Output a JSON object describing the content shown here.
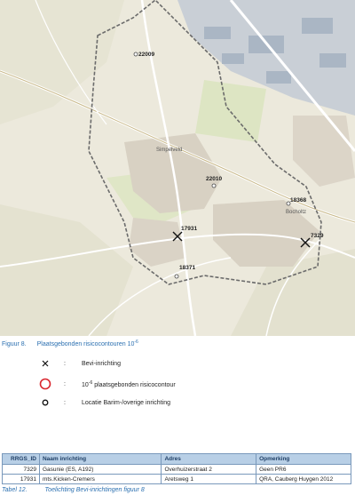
{
  "map": {
    "labels": [
      "22009",
      "22010",
      "18368",
      "17931",
      "7329",
      "18371"
    ],
    "place_names": [
      "Simpelveld",
      "Bocholtz"
    ],
    "colors": {
      "background": "#ece9dc",
      "urban": "#d7d1c4",
      "industrial": "#b9c3cf",
      "green": "#d9e3c0",
      "road": "#ffffff",
      "contour": "#6b6b6b",
      "label": "#222222"
    }
  },
  "figure_caption": {
    "number": "Figuur 8.",
    "text": "Plaatsgebonden risicocontouren 10",
    "exponent": "-6"
  },
  "legend": {
    "items": [
      {
        "symbol": "x",
        "colon": ":",
        "label": "Bevi-inrichting"
      },
      {
        "symbol": "red-circle",
        "colon": ":",
        "label_prefix": "10",
        "label_exp": "-6",
        "label_rest": " plaatsgebonden risicocontour"
      },
      {
        "symbol": "black-circle",
        "colon": ":",
        "label": "Locatie Barim-/overige inrichting"
      }
    ]
  },
  "table": {
    "headers": [
      "RRGS_ID",
      "Naam inrichting",
      "Adres",
      "Opmerking"
    ],
    "rows": [
      [
        "7329",
        "Gasunie (ES, A192)",
        "Overhuizerstraat 2",
        "Geen PR6"
      ],
      [
        "17931",
        "mts.Kicken-Cremers",
        "Aretsweg 1",
        "QRA, Cauberg Huygen 2012"
      ]
    ]
  },
  "table_caption": {
    "number": "Tabel 12.",
    "text": "Toelichting Bevi-inrichtingen figuur 8"
  }
}
